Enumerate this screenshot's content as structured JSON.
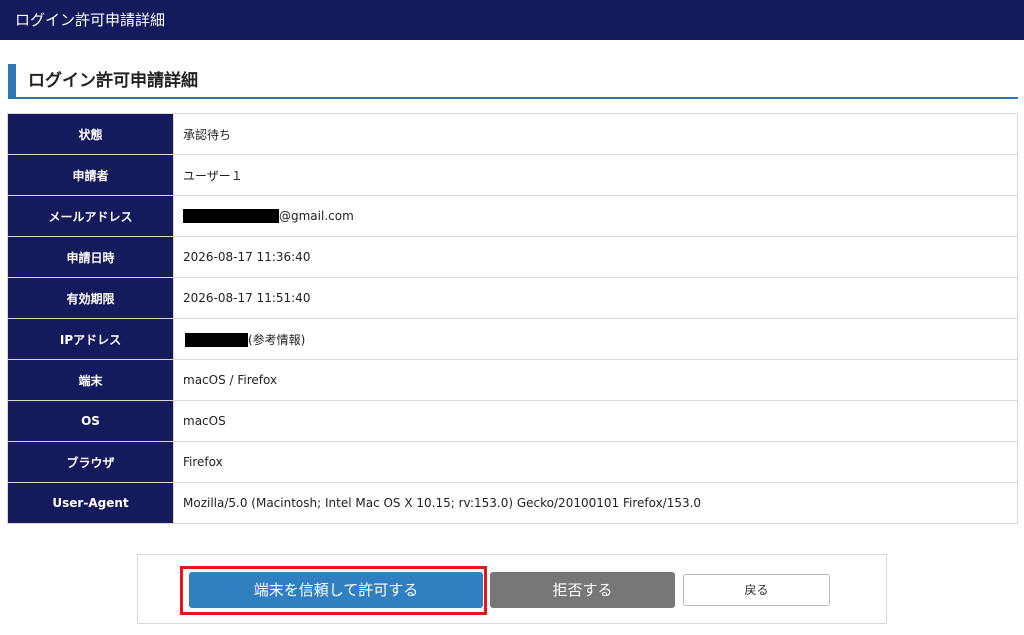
{
  "header": {
    "title": "ログイン許可申請詳細"
  },
  "section": {
    "title": "ログイン許可申請詳細"
  },
  "details": [
    {
      "label": "状態",
      "value": "承認待ち"
    },
    {
      "label": "申請者",
      "value": "ユーザー１"
    },
    {
      "label": "メールアドレス",
      "value": "@gmail.com"
    },
    {
      "label": "申請日時",
      "value": "2026-08-17 11:36:40"
    },
    {
      "label": "有効期限",
      "value": "2026-08-17 11:51:40"
    },
    {
      "label": "IPアドレス",
      "value": "(参考情報)"
    },
    {
      "label": "端末",
      "value": "macOS / Firefox"
    },
    {
      "label": "OS",
      "value": "macOS"
    },
    {
      "label": "ブラウザ",
      "value": "Firefox"
    },
    {
      "label": "User-Agent",
      "value": "Mozilla/5.0 (Macintosh; Intel Mac OS X 10.15; rv:153.0) Gecko/20100101 Firefox/153.0"
    }
  ],
  "actions": {
    "approve_label": "端末を信頼して許可する",
    "reject_label": "拒否する",
    "back_label": "戻る"
  },
  "colors": {
    "header_bg": "#151a5c",
    "accent": "#2e78b0",
    "approve_bg": "#2f7fc1",
    "reject_bg": "#777777",
    "highlight": "#e8141b"
  }
}
